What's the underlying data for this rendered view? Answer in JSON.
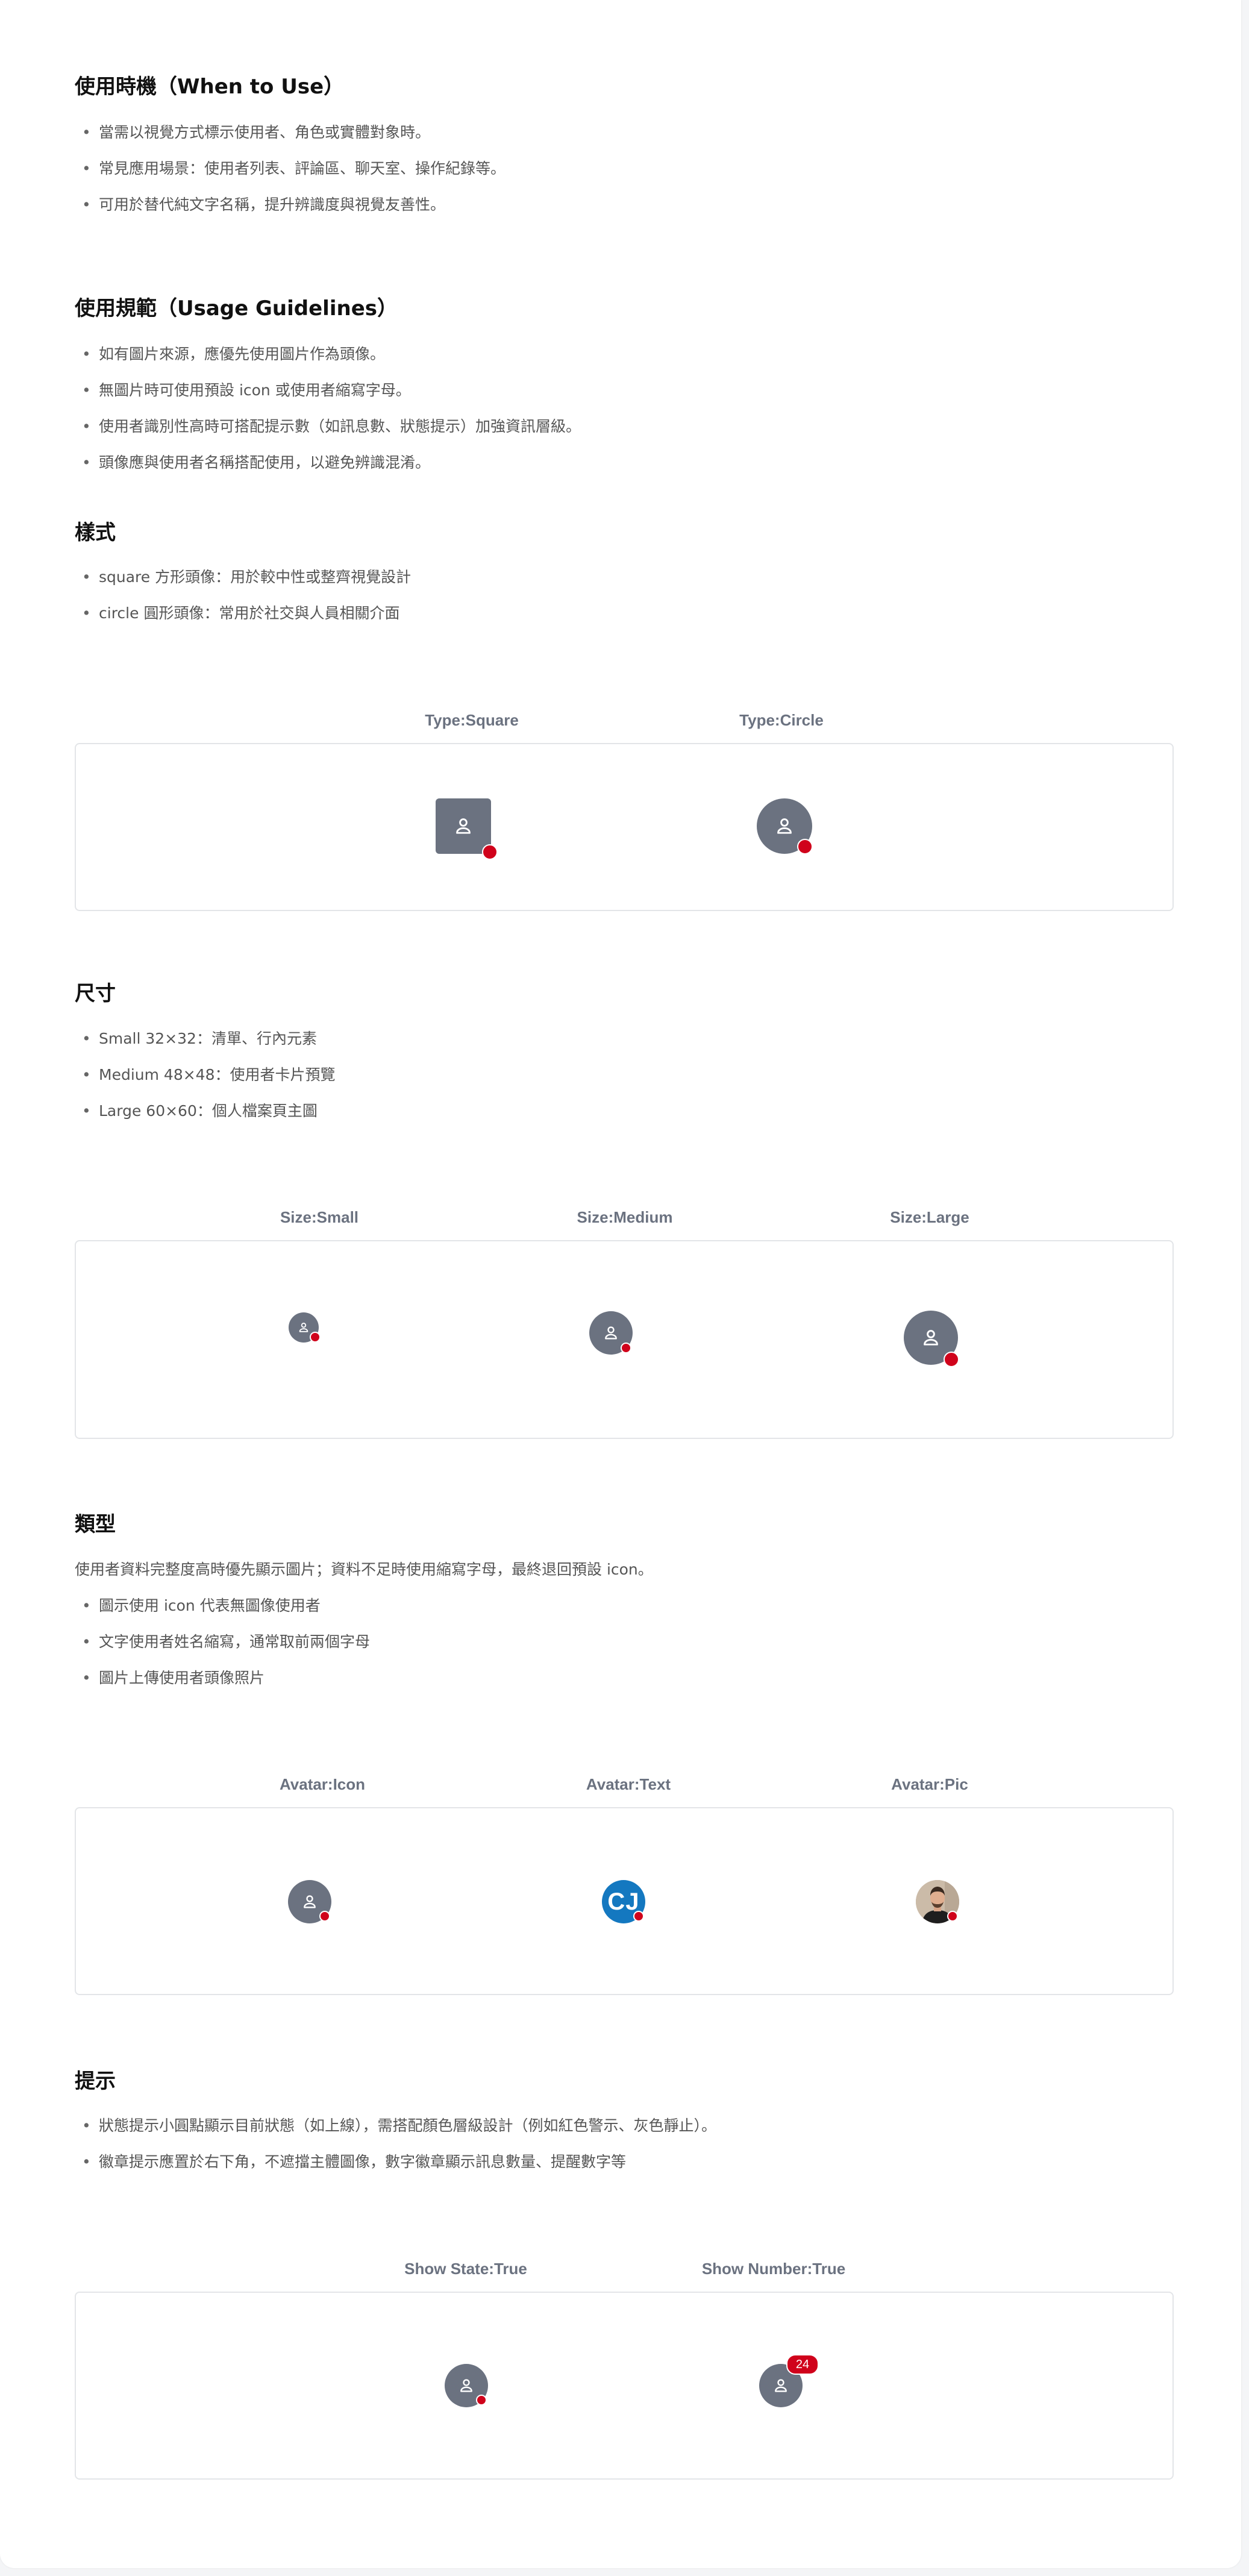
{
  "sections": {
    "when": {
      "title": "使用時機（When to Use）",
      "items": [
        "當需以視覺方式標示使用者、角色或實體對象時。",
        "常見應用場景：使用者列表、評論區、聊天室、操作紀錄等。",
        "可用於替代純文字名稱，提升辨識度與視覺友善性。"
      ]
    },
    "usage": {
      "title": "使用規範（Usage Guidelines）",
      "items": [
        "如有圖片來源，應優先使用圖片作為頭像。",
        "無圖片時可使用預設 icon 或使用者縮寫字母。",
        "使用者識別性高時可搭配提示數（如訊息數、狀態提示）加強資訊層級。",
        "頭像應與使用者名稱搭配使用，以避免辨識混淆。"
      ]
    },
    "style": {
      "title": "樣式",
      "items": [
        "square 方形頭像：用於較中性或整齊視覺設計",
        "circle 圓形頭像：常用於社交與人員相關介面"
      ],
      "demo_labels": [
        "Type:Square",
        "Type:Circle"
      ]
    },
    "size": {
      "title": "尺寸",
      "items": [
        "Small 32×32：清單、行內元素",
        "Medium 48×48：使用者卡片預覽",
        "Large 60×60：個人檔案頁主圖"
      ],
      "demo_labels": [
        "Size:Small",
        "Size:Medium",
        "Size:Large"
      ]
    },
    "types": {
      "title": "類型",
      "intro": "使用者資料完整度高時優先顯示圖片；資料不足時使用縮寫字母，最終退回預設 icon。",
      "items": [
        "圖示使用 icon 代表無圖像使用者",
        "文字使用者姓名縮寫，通常取前兩個字母",
        "圖片上傳使用者頭像照片"
      ],
      "demo_labels": [
        "Avatar:Icon",
        "Avatar:Text",
        "Avatar:Pic"
      ],
      "initials": "CJ"
    },
    "hints": {
      "title": "提示",
      "items": [
        "狀態提示小圓點顯示目前狀態（如上線），需搭配顏色層級設計（例如紅色警示、灰色靜止）。",
        "徽章提示應置於右下角，不遮擋主體圖像，數字徽章顯示訊息數量、提醒數字等"
      ],
      "demo_labels": [
        "Show State:True",
        "Show Number:True"
      ],
      "badge_number": "24"
    }
  },
  "colors": {
    "avatar_bg": "#6b7280",
    "status_dot": "#d0021b",
    "text_avatar_bg": "#1478c0",
    "border": "#e3e5e8"
  },
  "icons": {
    "avatar_default": "person-icon"
  }
}
